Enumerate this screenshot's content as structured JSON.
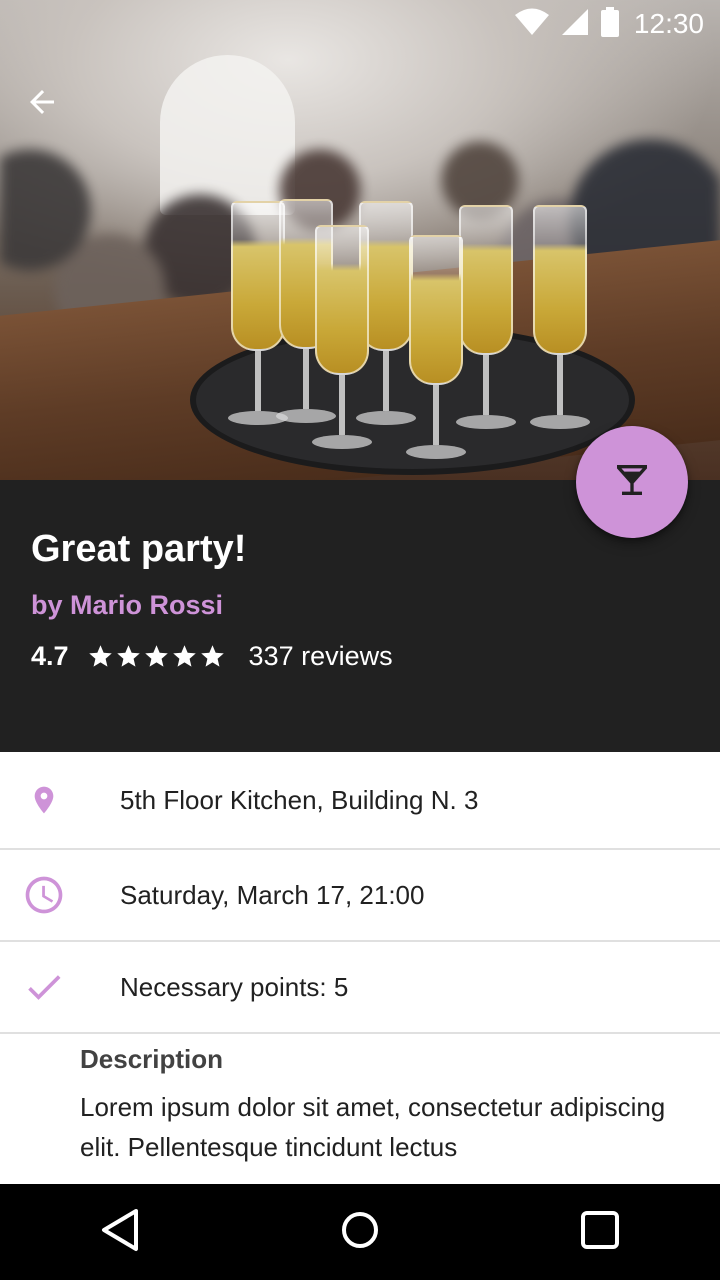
{
  "status_bar": {
    "time": "12:30",
    "icons": [
      "wifi-icon",
      "cell-signal-icon",
      "battery-icon"
    ]
  },
  "header": {
    "back_icon": "arrow-back-icon"
  },
  "event": {
    "title": "Great party!",
    "host": "by Mario Rossi",
    "rating": "4.7",
    "stars": 5,
    "reviews": "337 reviews"
  },
  "fab": {
    "icon": "cocktail-glass-icon"
  },
  "details": [
    {
      "icon": "location-pin-icon",
      "text": "5th Floor Kitchen, Building N. 3"
    },
    {
      "icon": "clock-icon",
      "text": "Saturday, March 17, 21:00"
    },
    {
      "icon": "check-icon",
      "text": "Necessary points: 5"
    }
  ],
  "description": {
    "title": "Description",
    "body": "Lorem ipsum dolor sit amet, consectetur adipiscing elit. Pellentesque tincidunt lectus"
  },
  "nav_bar": {
    "icons": [
      "back-triangle-icon",
      "home-circle-icon",
      "recents-square-icon"
    ]
  },
  "colors": {
    "accent": "#ce93d8",
    "panel": "#212121",
    "divider": "#e0e0e0"
  }
}
